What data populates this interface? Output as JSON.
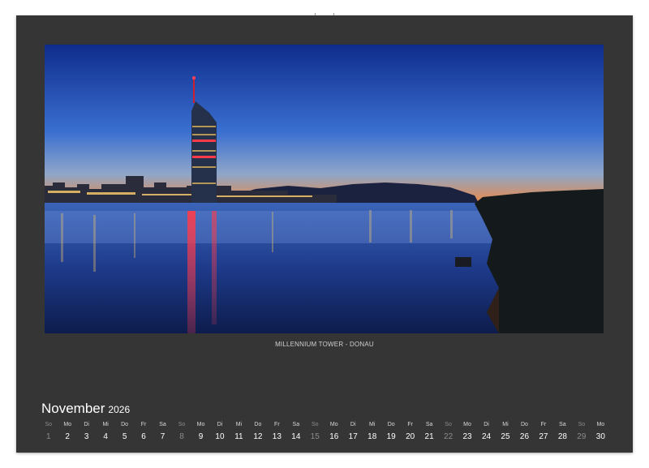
{
  "colors": {
    "sheet": "#353535",
    "text": "#ffffff",
    "weekend_text": "#8c8c8c",
    "sky_top": "#0f2c8c",
    "sky_horizon": "#e88a4a",
    "water": "#1e3a8a"
  },
  "photo": {
    "caption": "MILLENNIUM TOWER - DONAU"
  },
  "calendar": {
    "month": "November",
    "year": "2026",
    "days": [
      {
        "wd": "So",
        "d": "1",
        "weekend": true
      },
      {
        "wd": "Mo",
        "d": "2",
        "weekend": false
      },
      {
        "wd": "Di",
        "d": "3",
        "weekend": false
      },
      {
        "wd": "Mi",
        "d": "4",
        "weekend": false
      },
      {
        "wd": "Do",
        "d": "5",
        "weekend": false
      },
      {
        "wd": "Fr",
        "d": "6",
        "weekend": false
      },
      {
        "wd": "Sa",
        "d": "7",
        "weekend": false
      },
      {
        "wd": "So",
        "d": "8",
        "weekend": true
      },
      {
        "wd": "Mo",
        "d": "9",
        "weekend": false
      },
      {
        "wd": "Di",
        "d": "10",
        "weekend": false
      },
      {
        "wd": "Mi",
        "d": "11",
        "weekend": false
      },
      {
        "wd": "Do",
        "d": "12",
        "weekend": false
      },
      {
        "wd": "Fr",
        "d": "13",
        "weekend": false
      },
      {
        "wd": "Sa",
        "d": "14",
        "weekend": false
      },
      {
        "wd": "So",
        "d": "15",
        "weekend": true
      },
      {
        "wd": "Mo",
        "d": "16",
        "weekend": false
      },
      {
        "wd": "Di",
        "d": "17",
        "weekend": false
      },
      {
        "wd": "Mi",
        "d": "18",
        "weekend": false
      },
      {
        "wd": "Do",
        "d": "19",
        "weekend": false
      },
      {
        "wd": "Fr",
        "d": "20",
        "weekend": false
      },
      {
        "wd": "Sa",
        "d": "21",
        "weekend": false
      },
      {
        "wd": "So",
        "d": "22",
        "weekend": true
      },
      {
        "wd": "Mo",
        "d": "23",
        "weekend": false
      },
      {
        "wd": "Di",
        "d": "24",
        "weekend": false
      },
      {
        "wd": "Mi",
        "d": "25",
        "weekend": false
      },
      {
        "wd": "Do",
        "d": "26",
        "weekend": false
      },
      {
        "wd": "Fr",
        "d": "27",
        "weekend": false
      },
      {
        "wd": "Sa",
        "d": "28",
        "weekend": false
      },
      {
        "wd": "So",
        "d": "29",
        "weekend": true
      },
      {
        "wd": "Mo",
        "d": "30",
        "weekend": false
      }
    ]
  }
}
